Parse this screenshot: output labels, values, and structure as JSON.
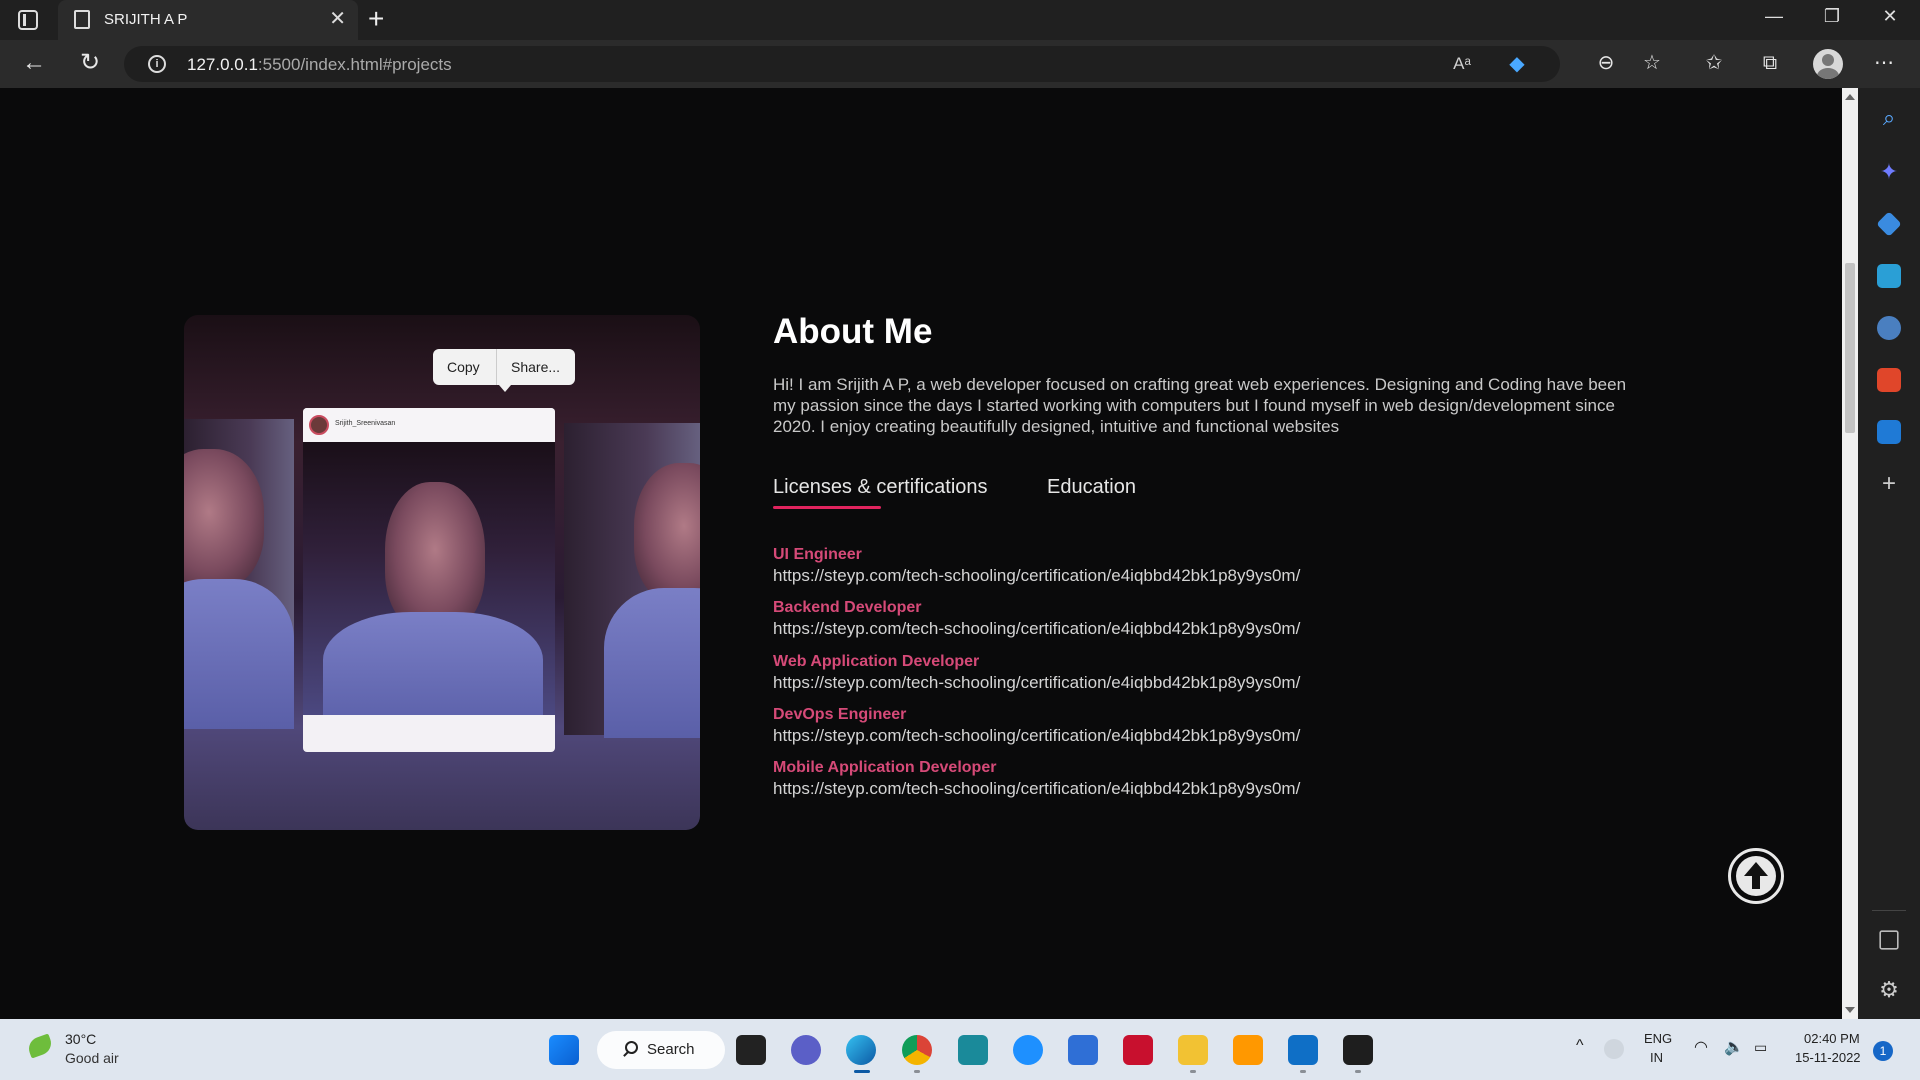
{
  "browser": {
    "tab_title": "SRIJITH A P",
    "url_host": "127.0.0.1",
    "url_path": ":5500/index.html#projects"
  },
  "photo": {
    "username": "Srijith_Sreenivasan",
    "popup_copy": "Copy",
    "popup_share": "Share..."
  },
  "about": {
    "title": "About Me",
    "text": "Hi! I am Srijith A P, a web developer focused on crafting great web experiences. Designing and Coding have been my passion since the days I started working with computers but I found myself in web design/development since 2020. I enjoy creating beautifully designed, intuitive and functional websites",
    "tabs": [
      "Licenses & certifications",
      "Education"
    ],
    "certifications": [
      {
        "title": "UI Engineer",
        "url": "https://steyp.com/tech-schooling/certification/e4iqbbd42bk1p8y9ys0m/"
      },
      {
        "title": "Backend Developer",
        "url": "https://steyp.com/tech-schooling/certification/e4iqbbd42bk1p8y9ys0m/"
      },
      {
        "title": "Web Application Developer",
        "url": "https://steyp.com/tech-schooling/certification/e4iqbbd42bk1p8y9ys0m/"
      },
      {
        "title": "DevOps Engineer",
        "url": "https://steyp.com/tech-schooling/certification/e4iqbbd42bk1p8y9ys0m/"
      },
      {
        "title": "Mobile Application Developer",
        "url": "https://steyp.com/tech-schooling/certification/e4iqbbd42bk1p8y9ys0m/"
      }
    ]
  },
  "taskbar": {
    "weather_temp": "30°C",
    "weather_desc": "Good air",
    "search_label": "Search",
    "lang_1": "ENG",
    "lang_2": "IN",
    "time": "02:40 PM",
    "date": "15-11-2022",
    "notifications": "1"
  },
  "colors": {
    "accent": "#e0245e",
    "cert_title": "#d64a78"
  }
}
